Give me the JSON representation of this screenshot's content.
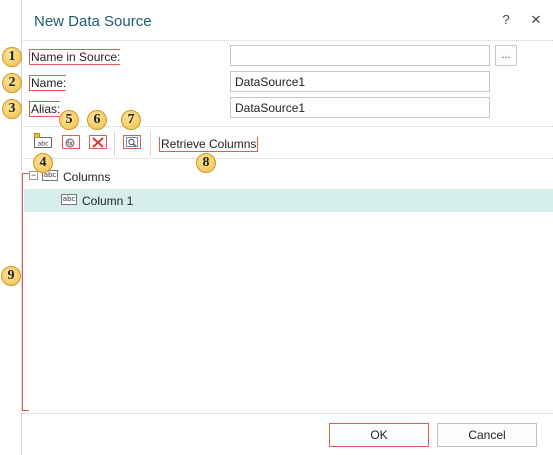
{
  "dialog": {
    "title": "New Data Source",
    "help_label": "?",
    "close_label": "✕"
  },
  "form": {
    "name_in_source_label": "Name in Source:",
    "name_in_source_value": "",
    "browse_label": "...",
    "name_label": "Name:",
    "name_value": "DataSource1",
    "alias_label": "Alias:",
    "alias_value": "DataSource1"
  },
  "toolbar": {
    "retrieve_columns_label": "Retrieve Columns"
  },
  "tree": {
    "root_label": "Columns",
    "root_expander": "−",
    "items": [
      {
        "label": "Column 1",
        "icon": "abc"
      }
    ],
    "root_icon": "abc"
  },
  "footer": {
    "ok_label": "OK",
    "cancel_label": "Cancel"
  },
  "callouts": [
    "1",
    "2",
    "3",
    "4",
    "5",
    "6",
    "7",
    "8",
    "9"
  ],
  "colors": {
    "title": "#1f5b70",
    "selection": "#d7efec",
    "callout_fill": "#f2bf4a",
    "annotation_red": "#e05a5a"
  }
}
